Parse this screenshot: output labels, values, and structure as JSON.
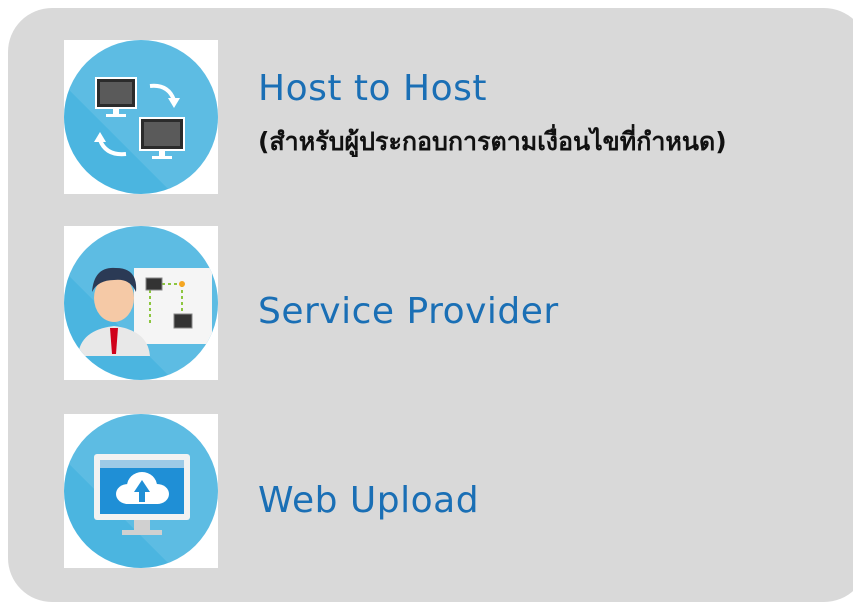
{
  "options": [
    {
      "title": "Host to Host",
      "subtitle": "(สำหรับผู้ประกอบการตามเงื่อนไขที่กำหนด)",
      "icon": "host-to-host-icon"
    },
    {
      "title": "Service Provider",
      "icon": "service-provider-icon"
    },
    {
      "title": "Web Upload",
      "icon": "web-upload-icon"
    }
  ],
  "colors": {
    "panel": "#d9d9d9",
    "title": "#1a6fb5",
    "icon_circle": "#4bb5e0"
  }
}
